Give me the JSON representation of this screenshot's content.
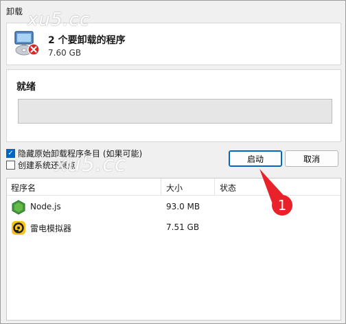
{
  "window": {
    "title": "卸载"
  },
  "watermark": {
    "text": "xu5.cc"
  },
  "header": {
    "title": "2 个要卸载的程序",
    "size": "7.60 GB"
  },
  "status": {
    "label": "就绪",
    "progress": 0
  },
  "options": [
    {
      "label": "隐藏原始卸载程序条目 (如果可能)",
      "checked": true
    },
    {
      "label": "创建系统还原点",
      "checked": false
    }
  ],
  "buttons": {
    "start": "启动",
    "cancel": "取消"
  },
  "table": {
    "columns": [
      "程序名",
      "大小",
      "状态"
    ],
    "rows": [
      {
        "name": "Node.js",
        "size": "93.0 MB",
        "status": "",
        "icon": "nodejs-icon"
      },
      {
        "name": "雷电模拟器",
        "size": "7.51 GB",
        "status": "",
        "icon": "ldplayer-icon"
      }
    ]
  },
  "annotation": {
    "badge": "1",
    "color": "#e8212a"
  },
  "colors": {
    "accent": "#0067c0",
    "progress_fill": "#06b025"
  }
}
